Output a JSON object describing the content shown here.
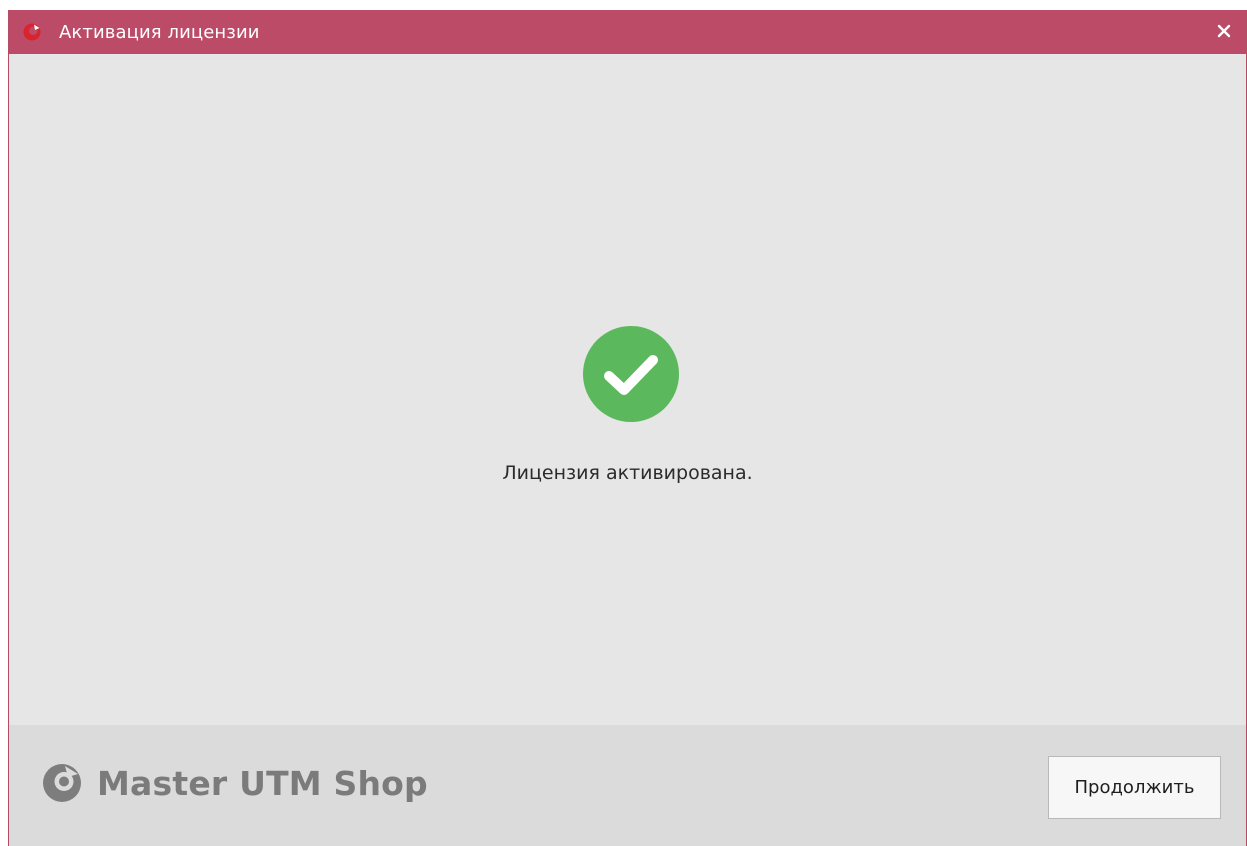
{
  "window": {
    "title": "Активация лицензии",
    "app_icon": "app-logo-icon",
    "close_icon": "close-icon",
    "close_glyph": "✕"
  },
  "content": {
    "status_icon": "check-circle-icon",
    "message": "Лицензия активирована."
  },
  "footer": {
    "brand_logo": "brand-logo-icon",
    "brand_name": "Master UTM Shop",
    "continue_label": "Продолжить"
  },
  "colors": {
    "titlebar": "#bb4b67",
    "success": "#5cb85c",
    "background": "#e6e6e6",
    "footer": "#dbdbdb",
    "brand_text": "#7b7b7b"
  }
}
